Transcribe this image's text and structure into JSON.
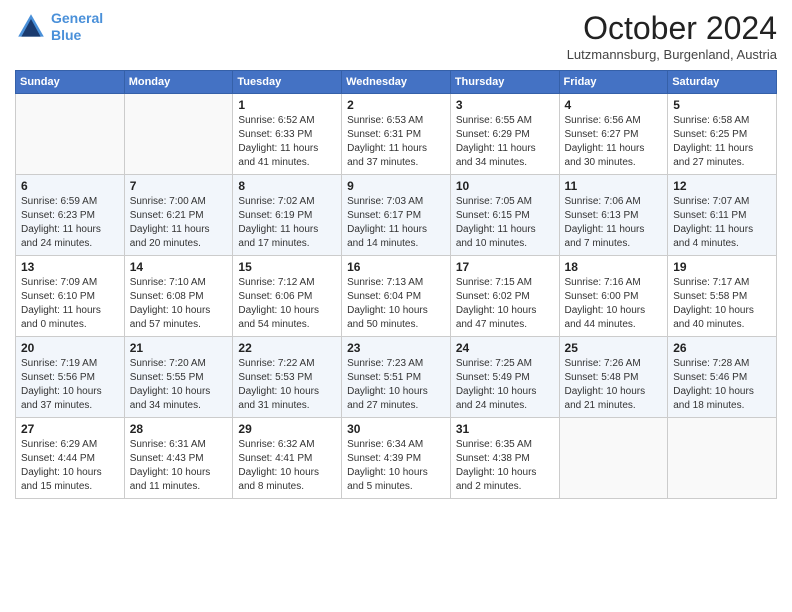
{
  "header": {
    "logo_line1": "General",
    "logo_line2": "Blue",
    "month": "October 2024",
    "location": "Lutzmannsburg, Burgenland, Austria"
  },
  "days_of_week": [
    "Sunday",
    "Monday",
    "Tuesday",
    "Wednesday",
    "Thursday",
    "Friday",
    "Saturday"
  ],
  "weeks": [
    [
      {
        "day": "",
        "info": ""
      },
      {
        "day": "",
        "info": ""
      },
      {
        "day": "1",
        "info": "Sunrise: 6:52 AM\nSunset: 6:33 PM\nDaylight: 11 hours and 41 minutes."
      },
      {
        "day": "2",
        "info": "Sunrise: 6:53 AM\nSunset: 6:31 PM\nDaylight: 11 hours and 37 minutes."
      },
      {
        "day": "3",
        "info": "Sunrise: 6:55 AM\nSunset: 6:29 PM\nDaylight: 11 hours and 34 minutes."
      },
      {
        "day": "4",
        "info": "Sunrise: 6:56 AM\nSunset: 6:27 PM\nDaylight: 11 hours and 30 minutes."
      },
      {
        "day": "5",
        "info": "Sunrise: 6:58 AM\nSunset: 6:25 PM\nDaylight: 11 hours and 27 minutes."
      }
    ],
    [
      {
        "day": "6",
        "info": "Sunrise: 6:59 AM\nSunset: 6:23 PM\nDaylight: 11 hours and 24 minutes."
      },
      {
        "day": "7",
        "info": "Sunrise: 7:00 AM\nSunset: 6:21 PM\nDaylight: 11 hours and 20 minutes."
      },
      {
        "day": "8",
        "info": "Sunrise: 7:02 AM\nSunset: 6:19 PM\nDaylight: 11 hours and 17 minutes."
      },
      {
        "day": "9",
        "info": "Sunrise: 7:03 AM\nSunset: 6:17 PM\nDaylight: 11 hours and 14 minutes."
      },
      {
        "day": "10",
        "info": "Sunrise: 7:05 AM\nSunset: 6:15 PM\nDaylight: 11 hours and 10 minutes."
      },
      {
        "day": "11",
        "info": "Sunrise: 7:06 AM\nSunset: 6:13 PM\nDaylight: 11 hours and 7 minutes."
      },
      {
        "day": "12",
        "info": "Sunrise: 7:07 AM\nSunset: 6:11 PM\nDaylight: 11 hours and 4 minutes."
      }
    ],
    [
      {
        "day": "13",
        "info": "Sunrise: 7:09 AM\nSunset: 6:10 PM\nDaylight: 11 hours and 0 minutes."
      },
      {
        "day": "14",
        "info": "Sunrise: 7:10 AM\nSunset: 6:08 PM\nDaylight: 10 hours and 57 minutes."
      },
      {
        "day": "15",
        "info": "Sunrise: 7:12 AM\nSunset: 6:06 PM\nDaylight: 10 hours and 54 minutes."
      },
      {
        "day": "16",
        "info": "Sunrise: 7:13 AM\nSunset: 6:04 PM\nDaylight: 10 hours and 50 minutes."
      },
      {
        "day": "17",
        "info": "Sunrise: 7:15 AM\nSunset: 6:02 PM\nDaylight: 10 hours and 47 minutes."
      },
      {
        "day": "18",
        "info": "Sunrise: 7:16 AM\nSunset: 6:00 PM\nDaylight: 10 hours and 44 minutes."
      },
      {
        "day": "19",
        "info": "Sunrise: 7:17 AM\nSunset: 5:58 PM\nDaylight: 10 hours and 40 minutes."
      }
    ],
    [
      {
        "day": "20",
        "info": "Sunrise: 7:19 AM\nSunset: 5:56 PM\nDaylight: 10 hours and 37 minutes."
      },
      {
        "day": "21",
        "info": "Sunrise: 7:20 AM\nSunset: 5:55 PM\nDaylight: 10 hours and 34 minutes."
      },
      {
        "day": "22",
        "info": "Sunrise: 7:22 AM\nSunset: 5:53 PM\nDaylight: 10 hours and 31 minutes."
      },
      {
        "day": "23",
        "info": "Sunrise: 7:23 AM\nSunset: 5:51 PM\nDaylight: 10 hours and 27 minutes."
      },
      {
        "day": "24",
        "info": "Sunrise: 7:25 AM\nSunset: 5:49 PM\nDaylight: 10 hours and 24 minutes."
      },
      {
        "day": "25",
        "info": "Sunrise: 7:26 AM\nSunset: 5:48 PM\nDaylight: 10 hours and 21 minutes."
      },
      {
        "day": "26",
        "info": "Sunrise: 7:28 AM\nSunset: 5:46 PM\nDaylight: 10 hours and 18 minutes."
      }
    ],
    [
      {
        "day": "27",
        "info": "Sunrise: 6:29 AM\nSunset: 4:44 PM\nDaylight: 10 hours and 15 minutes."
      },
      {
        "day": "28",
        "info": "Sunrise: 6:31 AM\nSunset: 4:43 PM\nDaylight: 10 hours and 11 minutes."
      },
      {
        "day": "29",
        "info": "Sunrise: 6:32 AM\nSunset: 4:41 PM\nDaylight: 10 hours and 8 minutes."
      },
      {
        "day": "30",
        "info": "Sunrise: 6:34 AM\nSunset: 4:39 PM\nDaylight: 10 hours and 5 minutes."
      },
      {
        "day": "31",
        "info": "Sunrise: 6:35 AM\nSunset: 4:38 PM\nDaylight: 10 hours and 2 minutes."
      },
      {
        "day": "",
        "info": ""
      },
      {
        "day": "",
        "info": ""
      }
    ]
  ]
}
